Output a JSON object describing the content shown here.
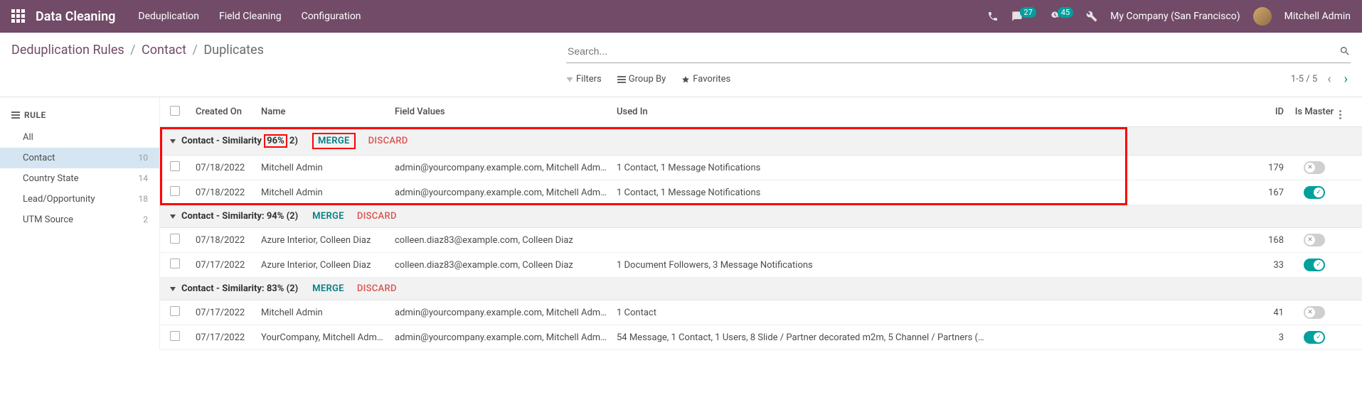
{
  "navbar": {
    "brand": "Data Cleaning",
    "menu": [
      "Deduplication",
      "Field Cleaning",
      "Configuration"
    ],
    "msg_count": "27",
    "activity_count": "45",
    "company": "My Company (San Francisco)",
    "user": "Mitchell Admin"
  },
  "breadcrumb": {
    "parts": [
      "Deduplication Rules",
      "Contact",
      "Duplicates"
    ]
  },
  "search": {
    "placeholder": "Search..."
  },
  "controls": {
    "filters": "Filters",
    "groupby": "Group By",
    "favorites": "Favorites",
    "pager": "1-5 / 5"
  },
  "sidebar": {
    "header": "RULE",
    "items": [
      {
        "label": "All",
        "count": ""
      },
      {
        "label": "Contact",
        "count": "10",
        "active": true
      },
      {
        "label": "Country State",
        "count": "14"
      },
      {
        "label": "Lead/Opportunity",
        "count": "18"
      },
      {
        "label": "UTM Source",
        "count": "2"
      }
    ]
  },
  "table": {
    "headers": {
      "created": "Created On",
      "name": "Name",
      "field": "Field Values",
      "used": "Used In",
      "id": "ID",
      "master": "Is Master"
    }
  },
  "groups": [
    {
      "similarity_prefix": "Contact - Similarity",
      "similarity_pct": "96%",
      "count_suffix": "2)",
      "merge": "MERGE",
      "discard": "DISCARD",
      "highlighted": true,
      "rows": [
        {
          "created": "07/18/2022",
          "name": "Mitchell Admin",
          "field": "admin@yourcompany.example.com, Mitchell Adm…",
          "used": "1 Contact, 1 Message Notifications",
          "id": "179",
          "master": false
        },
        {
          "created": "07/18/2022",
          "name": "Mitchell Admin",
          "field": "admin@yourcompany.example.com, Mitchell Adm…",
          "used": "1 Contact, 1 Message Notifications",
          "id": "167",
          "master": true
        }
      ]
    },
    {
      "label": "Contact - Similarity: 94% (2)",
      "merge": "MERGE",
      "discard": "DISCARD",
      "rows": [
        {
          "created": "07/18/2022",
          "name": "Azure Interior, Colleen Diaz",
          "field": "colleen.diaz83@example.com, Colleen Diaz",
          "used": "",
          "id": "168",
          "master": false
        },
        {
          "created": "07/17/2022",
          "name": "Azure Interior, Colleen Diaz",
          "field": "colleen.diaz83@example.com, Colleen Diaz",
          "used": "1 Document Followers, 3 Message Notifications",
          "id": "33",
          "master": true
        }
      ]
    },
    {
      "label": "Contact - Similarity: 83% (2)",
      "merge": "MERGE",
      "discard": "DISCARD",
      "rows": [
        {
          "created": "07/17/2022",
          "name": "Mitchell Admin",
          "field": "admin@yourcompany.example.com, Mitchell Adm…",
          "used": "1 Contact",
          "id": "41",
          "master": false
        },
        {
          "created": "07/17/2022",
          "name": "YourCompany, Mitchell Adm…",
          "field": "admin@yourcompany.example.com, Mitchell Adm…",
          "used": "54 Message, 1 Contact, 1 Users, 8 Slide / Partner decorated m2m, 5 Channel / Partners (…",
          "id": "3",
          "master": true
        }
      ]
    }
  ]
}
